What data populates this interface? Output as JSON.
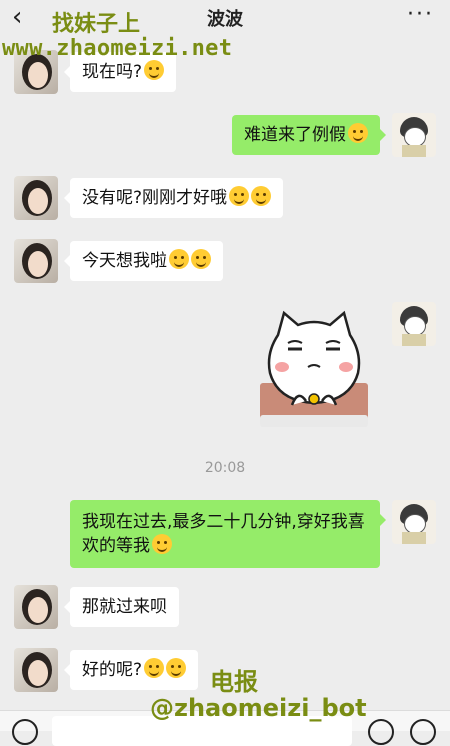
{
  "header": {
    "back_icon": "‹",
    "title": "波波",
    "more_icon": "···"
  },
  "watermarks": {
    "name": "找妹子上",
    "site": "www.zhaomeizi.net",
    "telegram_label": "电报",
    "telegram_handle": "@zhaomeizi_bot"
  },
  "messages": [
    {
      "side": "left",
      "text": "现在吗?",
      "emoji_count": 1
    },
    {
      "side": "right",
      "text": "难道来了例假",
      "emoji_count": 1
    },
    {
      "side": "left",
      "text": "没有呢?刚刚才好哦",
      "emoji_count": 2
    },
    {
      "side": "left",
      "text": "今天想我啦",
      "emoji_count": 2
    },
    {
      "side": "right",
      "type": "sticker"
    },
    {
      "side": "right",
      "text": "我现在过去,最多二十几分钟,穿好我喜欢的等我",
      "emoji_count": 1
    },
    {
      "side": "left",
      "text": "那就过来呗",
      "emoji_count": 0
    },
    {
      "side": "left",
      "text": "好的呢?",
      "emoji_count": 2
    }
  ],
  "timestamp": "20:08",
  "colors": {
    "background": "#ededed",
    "bubble_sent": "#95ec69",
    "bubble_received": "#ffffff",
    "watermark": "#7a8d13"
  }
}
